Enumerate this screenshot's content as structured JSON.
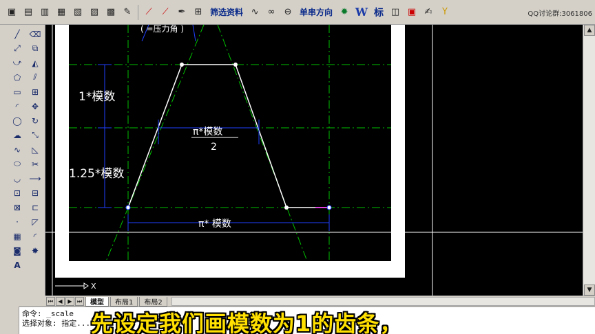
{
  "toolbar": {
    "filter_label": "筛选资料",
    "direction_label": "单串方向",
    "w_label": "W",
    "mark_label": "标",
    "qq_group": "QQ讨论群:3061806"
  },
  "drawing": {
    "label_pressure_angle": "( =压力角 )",
    "label_addendum": "1*模数",
    "label_dedendum": "1.25*模数",
    "label_half_pitch_num": "π*模数",
    "label_half_pitch_den": "2",
    "label_pitch": "π* 模数",
    "ucs_x": "X"
  },
  "layout_tabs": [
    "模型",
    "布局1",
    "布局2"
  ],
  "command_lines": [
    "命令: _scale",
    "选择对象: 指定..."
  ],
  "subtitle": "先设定我们画模数为1的齿条，",
  "colors": {
    "canvas": "#000000",
    "paper": "#ffffff",
    "dashdot_line": "#00c000",
    "dimension": "#2040ff",
    "profile": "#ffffff",
    "subtitle": "#ffe000"
  }
}
